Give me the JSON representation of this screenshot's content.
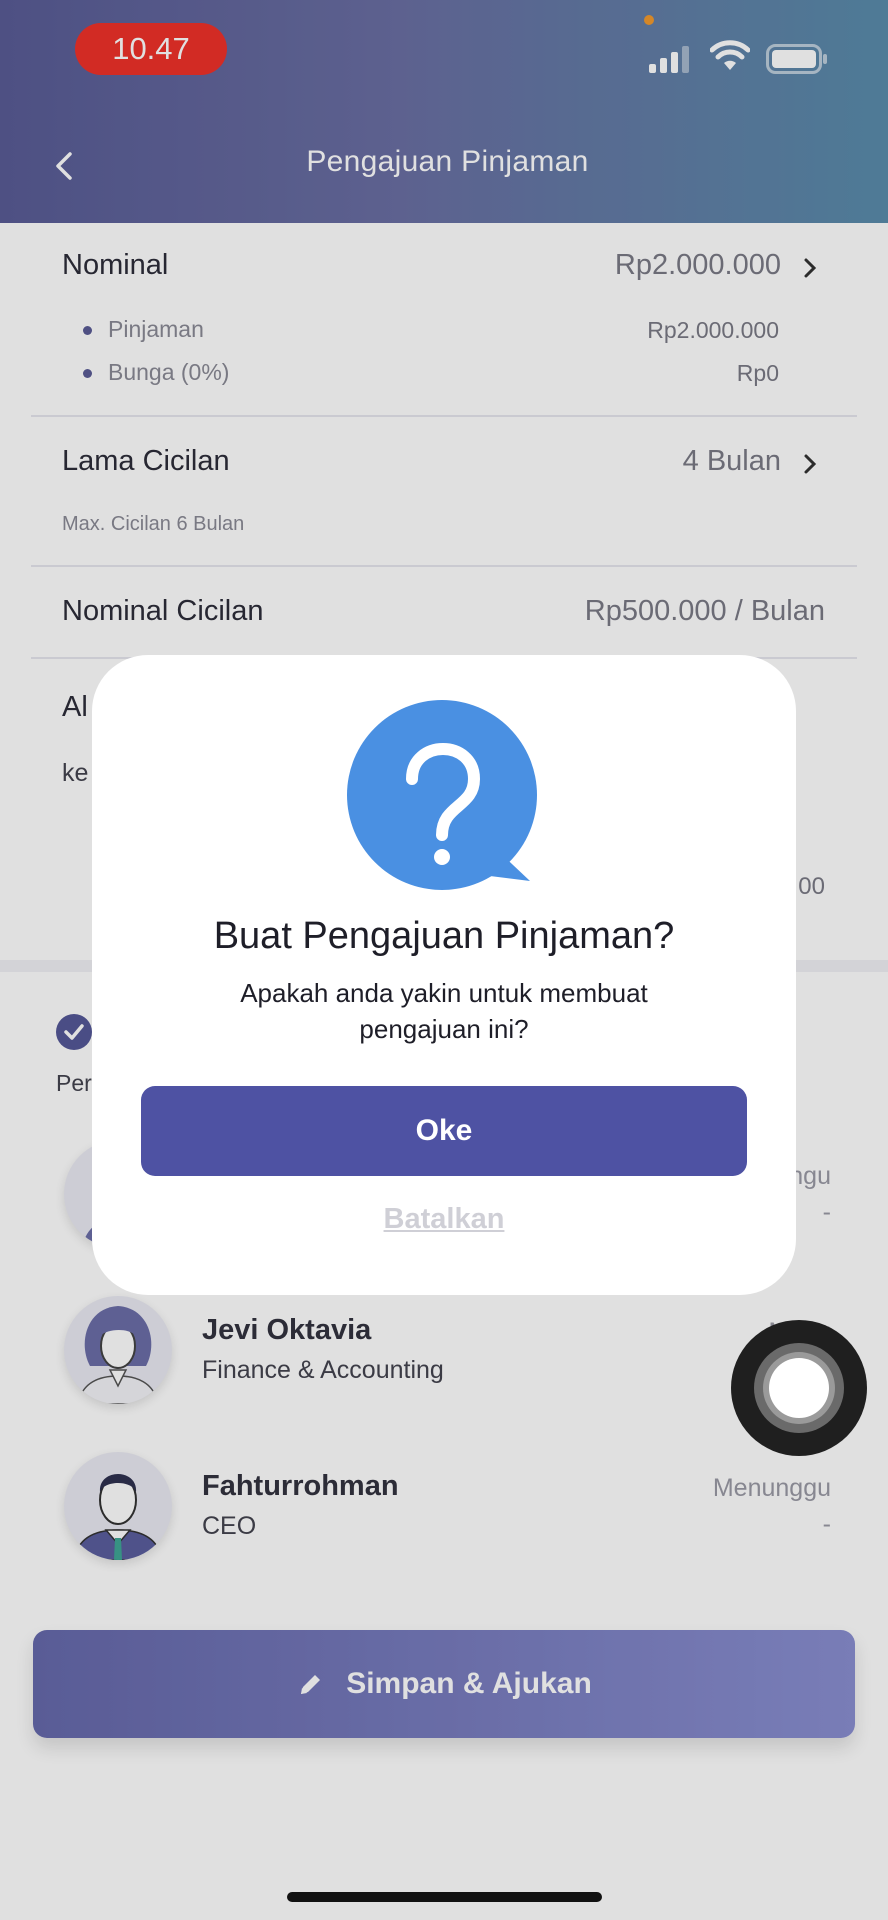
{
  "status_bar": {
    "time": "10.47"
  },
  "header": {
    "title": "Pengajuan Pinjaman"
  },
  "nominal": {
    "label": "Nominal",
    "value": "Rp2.000.000",
    "items": [
      {
        "label": "Pinjaman",
        "value": "Rp2.000.000"
      },
      {
        "label": "Bunga (0%)",
        "value": "Rp0"
      }
    ]
  },
  "lama_cicilan": {
    "label": "Lama Cicilan",
    "value": "4 Bulan",
    "note": "Max. Cicilan 6 Bulan"
  },
  "nominal_cicilan": {
    "label": "Nominal Cicilan",
    "value": "Rp500.000 / Bulan"
  },
  "partial": {
    "row_title": "Al",
    "row_text": "ke",
    "row_value": "00",
    "section_text": "Per",
    "first_status": "ngu",
    "first_date": "-"
  },
  "approvers": [
    {
      "name": "Jevi Oktavia",
      "role": "Finance & Accounting",
      "status": "Menu",
      "date": "-"
    },
    {
      "name": "Fahturrohman",
      "role": "CEO",
      "status": "Menunggu",
      "date": "-"
    }
  ],
  "submit_button": {
    "label": "Simpan & Ajukan"
  },
  "modal": {
    "title": "Buat Pengajuan Pinjaman?",
    "message": "Apakah anda yakin untuk membuat pengajuan ini?",
    "ok_label": "Oke",
    "cancel_label": "Batalkan"
  },
  "colors": {
    "primary": "#4e52a3",
    "header_start": "#595c96",
    "header_end": "#5a8cab",
    "icon_blue": "#4a90e2",
    "time_pill": "#f0322a"
  }
}
